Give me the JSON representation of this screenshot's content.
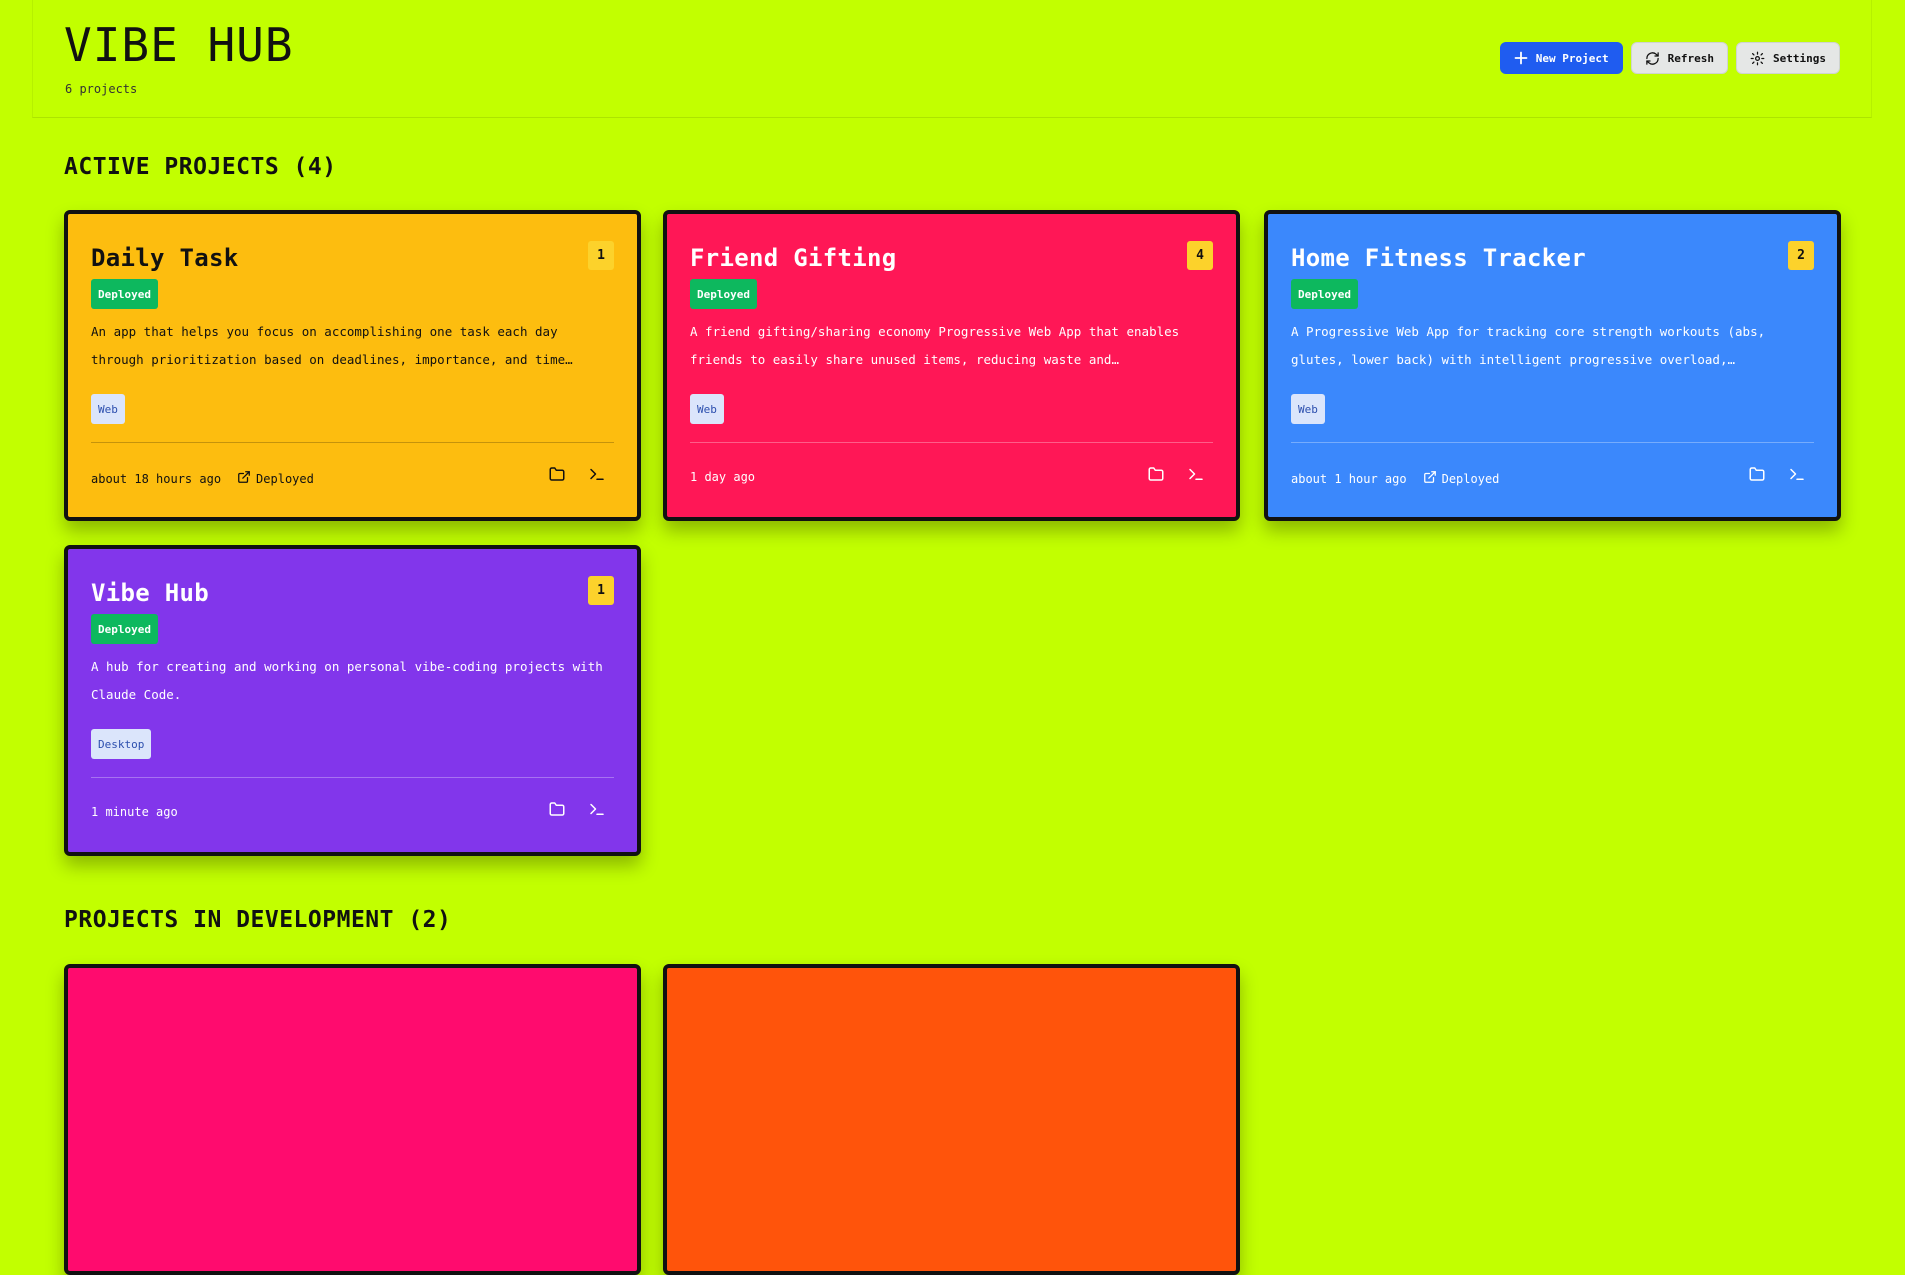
{
  "app": {
    "title": "VIBE HUB",
    "subtitle": "6 projects"
  },
  "toolbar": {
    "new_project": "New Project",
    "refresh": "Refresh",
    "settings": "Settings"
  },
  "colors": {
    "background": "#c2ff00",
    "primary_button": "#1f5cf0",
    "status_deployed": "#0db85e",
    "count_badge": "#fcd22b",
    "card_daily_task": "#fdbd0f",
    "card_friend_gifting": "#ff1756",
    "card_home_fitness": "#3b88fc",
    "card_vibe_hub": "#8236eb",
    "card_dev_1": "#ff0b6e",
    "card_dev_2": "#ff540b"
  },
  "sections": {
    "active": {
      "title": "ACTIVE PROJECTS (4)"
    },
    "development": {
      "title": "PROJECTS IN DEVELOPMENT (2)"
    }
  },
  "active_projects": [
    {
      "name": "Daily Task",
      "count": "1",
      "status": "Deployed",
      "description": "An app that helps you focus on accomplishing one task each day through prioritization based on deadlines, importance, and time availability.",
      "tag": "Web",
      "updated": "about 18 hours ago",
      "deploy_link": "Deployed",
      "icons": [
        "folder-icon",
        "terminal-icon"
      ]
    },
    {
      "name": "Friend Gifting",
      "count": "4",
      "status": "Deployed",
      "description": "A friend gifting/sharing economy Progressive Web App that enables friends to easily share unused items, reducing waste and strengthening…",
      "tag": "Web",
      "updated": "1 day ago",
      "icons": [
        "folder-icon",
        "terminal-icon"
      ]
    },
    {
      "name": "Home Fitness Tracker",
      "count": "2",
      "status": "Deployed",
      "description": "A Progressive Web App for tracking core strength workouts (abs, glutes, lower back) with intelligent progressive overload, personalized workout…",
      "tag": "Web",
      "updated": "about 1 hour ago",
      "deploy_link": "Deployed",
      "icons": [
        "folder-icon",
        "terminal-icon"
      ]
    },
    {
      "name": "Vibe Hub",
      "count": "1",
      "status": "Deployed",
      "description": "A hub for creating and working on personal vibe-coding projects with Claude Code.",
      "tag": "Desktop",
      "updated": "1 minute ago",
      "icons": [
        "folder-icon",
        "terminal-icon"
      ]
    }
  ]
}
